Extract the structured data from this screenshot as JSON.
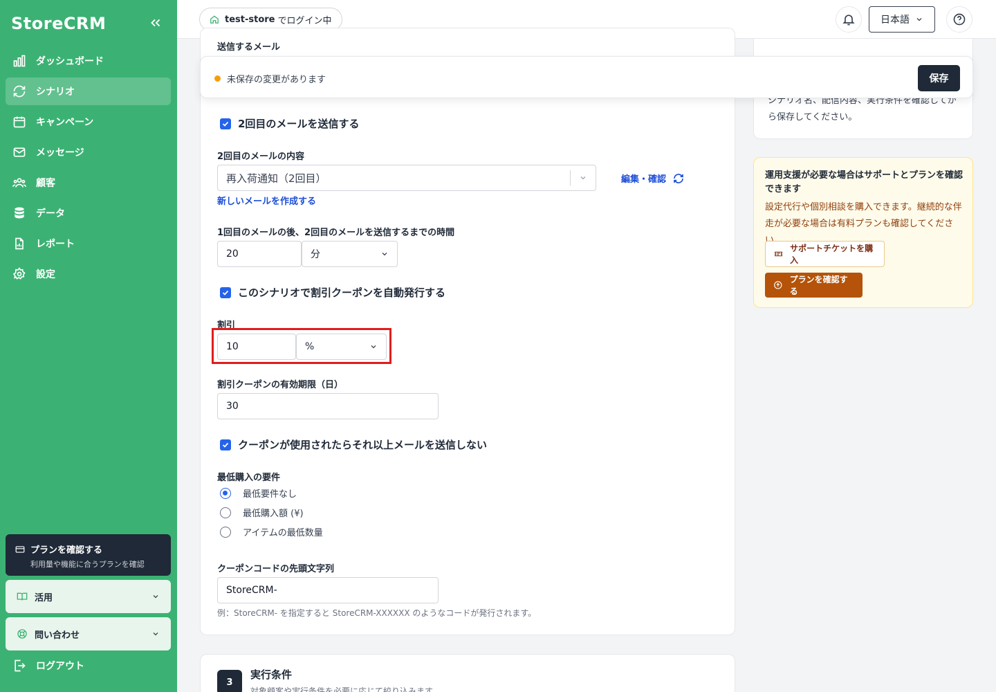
{
  "sidebar": {
    "logo": "StoreCRM",
    "items": [
      {
        "label": "ダッシュボード"
      },
      {
        "label": "シナリオ"
      },
      {
        "label": "キャンペーン"
      },
      {
        "label": "メッセージ"
      },
      {
        "label": "顧客"
      },
      {
        "label": "データ"
      },
      {
        "label": "レポート"
      },
      {
        "label": "設定"
      }
    ],
    "plan_title": "プランを確認する",
    "plan_sub": "利用量や機能に合うプランを確認",
    "usage": "活用",
    "contact": "問い合わせ",
    "logout": "ログアウト"
  },
  "topbar": {
    "store": "test-store",
    "login_suffix": "でログイン中",
    "language": "日本語"
  },
  "unsaved": {
    "message": "未保存の変更があります",
    "save": "保存"
  },
  "form": {
    "send_mail_label": "送信するメール",
    "second_mail_checkbox": "2回目のメールを送信する",
    "second_mail_content_label": "2回目のメールの内容",
    "second_mail_value": "再入荷通知（2回目）",
    "edit_confirm": "編集・確認",
    "create_new_mail": "新しいメールを作成する",
    "delay_label": "1回目のメールの後、2回目のメールを送信するまでの時間",
    "delay_value": "20",
    "delay_unit": "分",
    "coupon_checkbox": "このシナリオで割引クーポンを自動発行する",
    "discount_label": "割引",
    "discount_value": "10",
    "discount_unit": "%",
    "validity_label": "割引クーポンの有効期限（日）",
    "validity_value": "30",
    "stop_checkbox": "クーポンが使用されたらそれ以上メールを送信しない",
    "min_purchase_label": "最低購入の要件",
    "min_options": [
      "最低要件なし",
      "最低購入額 (¥)",
      "アイテムの最低数量"
    ],
    "prefix_label": "クーポンコードの先頭文字列",
    "prefix_value": "StoreCRM-",
    "prefix_hint": "例：StoreCRM- を指定すると StoreCRM-XXXXXX のようなコードが発行されます。"
  },
  "right": {
    "summary_text": "シナリオ名、配信内容、実行条件を確認してから保存してください。",
    "support_title": "運用支援が必要な場合はサポートとプランを確認できます",
    "support_text": "設定代行や個別相談を購入できます。継続的な伴走が必要な場合は有料プランも確認してください。",
    "ticket_button": "サポートチケットを購入",
    "plan_button": "プランを確認する"
  },
  "section3": {
    "step": "3",
    "title": "実行条件",
    "subtitle": "対象顧客や実行条件を必要に応じて絞り込みます"
  }
}
